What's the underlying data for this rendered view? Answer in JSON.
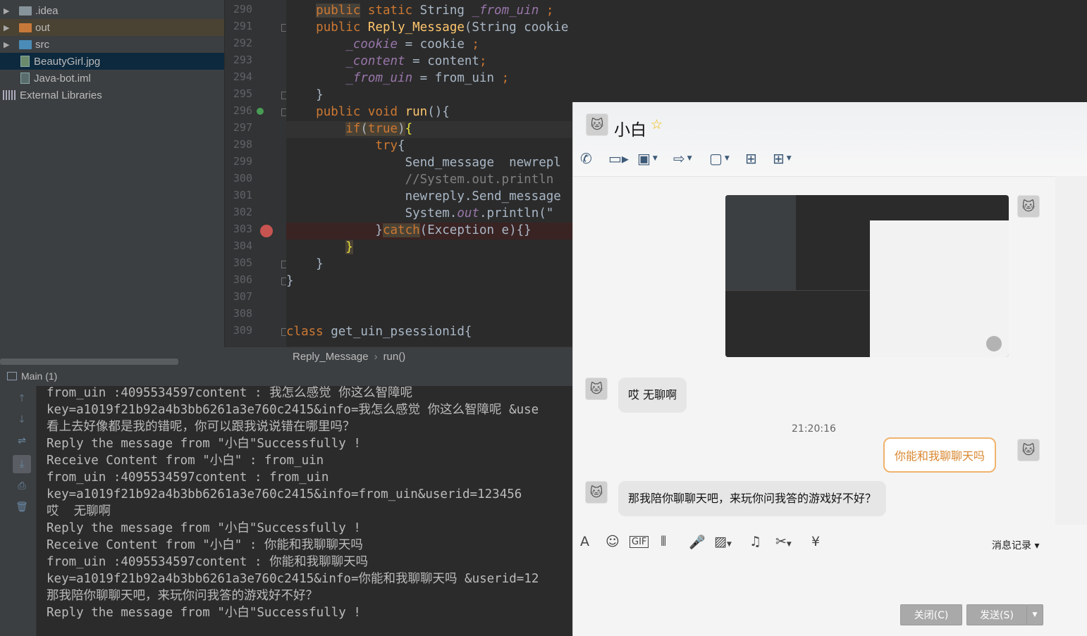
{
  "project_tree": {
    "items": [
      {
        "label": ".idea"
      },
      {
        "label": "out"
      },
      {
        "label": "src"
      },
      {
        "label": "BeautyGirl.jpg"
      },
      {
        "label": "Java-bot.iml"
      },
      {
        "label": "External Libraries"
      }
    ]
  },
  "editor": {
    "line_numbers": [
      "290",
      "291",
      "292",
      "293",
      "294",
      "295",
      "296",
      "297",
      "298",
      "299",
      "300",
      "301",
      "302",
      "303",
      "304",
      "305",
      "306",
      "307",
      "308",
      "309"
    ],
    "breadcrumb": [
      "Reply_Message",
      "run()"
    ]
  },
  "run_panel": {
    "title": "Main (1)",
    "lines": [
      "from_uin :4095534597content : 我怎么感觉 你这么智障呢",
      "key=a1019f21b92a4b3bb6261a3e760c2415&info=我怎么感觉 你这么智障呢 &use",
      "看上去好像都是我的错呢，你可以跟我说说错在哪里吗？",
      "Reply the message from \"小白\"Successfully !",
      "Receive Content from \"小白\" : from_uin",
      "from_uin :4095534597content : from_uin",
      "key=a1019f21b92a4b3bb6261a3e760c2415&info=from_uin&userid=123456",
      "哎  无聊啊",
      "Reply the message from \"小白\"Successfully !",
      "Receive Content from \"小白\" : 你能和我聊聊天吗",
      "from_uin :4095534597content : 你能和我聊聊天吗",
      "key=a1019f21b92a4b3bb6261a3e760c2415&info=你能和我聊聊天吗 &userid=12",
      "那我陪你聊聊天吧，来玩你问我答的游戏好不好？",
      "Reply the message from \"小白\"Successfully !"
    ]
  },
  "chat": {
    "title": "小白",
    "messages": {
      "m1": "哎  无聊啊",
      "time": "21:20:16",
      "m2": "你能和我聊聊天吗",
      "m3": "那我陪你聊聊天吧，来玩你问我答的游戏好不好？"
    },
    "history_label": "消息记录 ▾",
    "close_label": "关闭(C)",
    "send_label": "发送(S)"
  },
  "colors": {
    "accent": "#f0b36d",
    "ide_bg": "#2b2b2b",
    "keyword": "#cc7832"
  }
}
